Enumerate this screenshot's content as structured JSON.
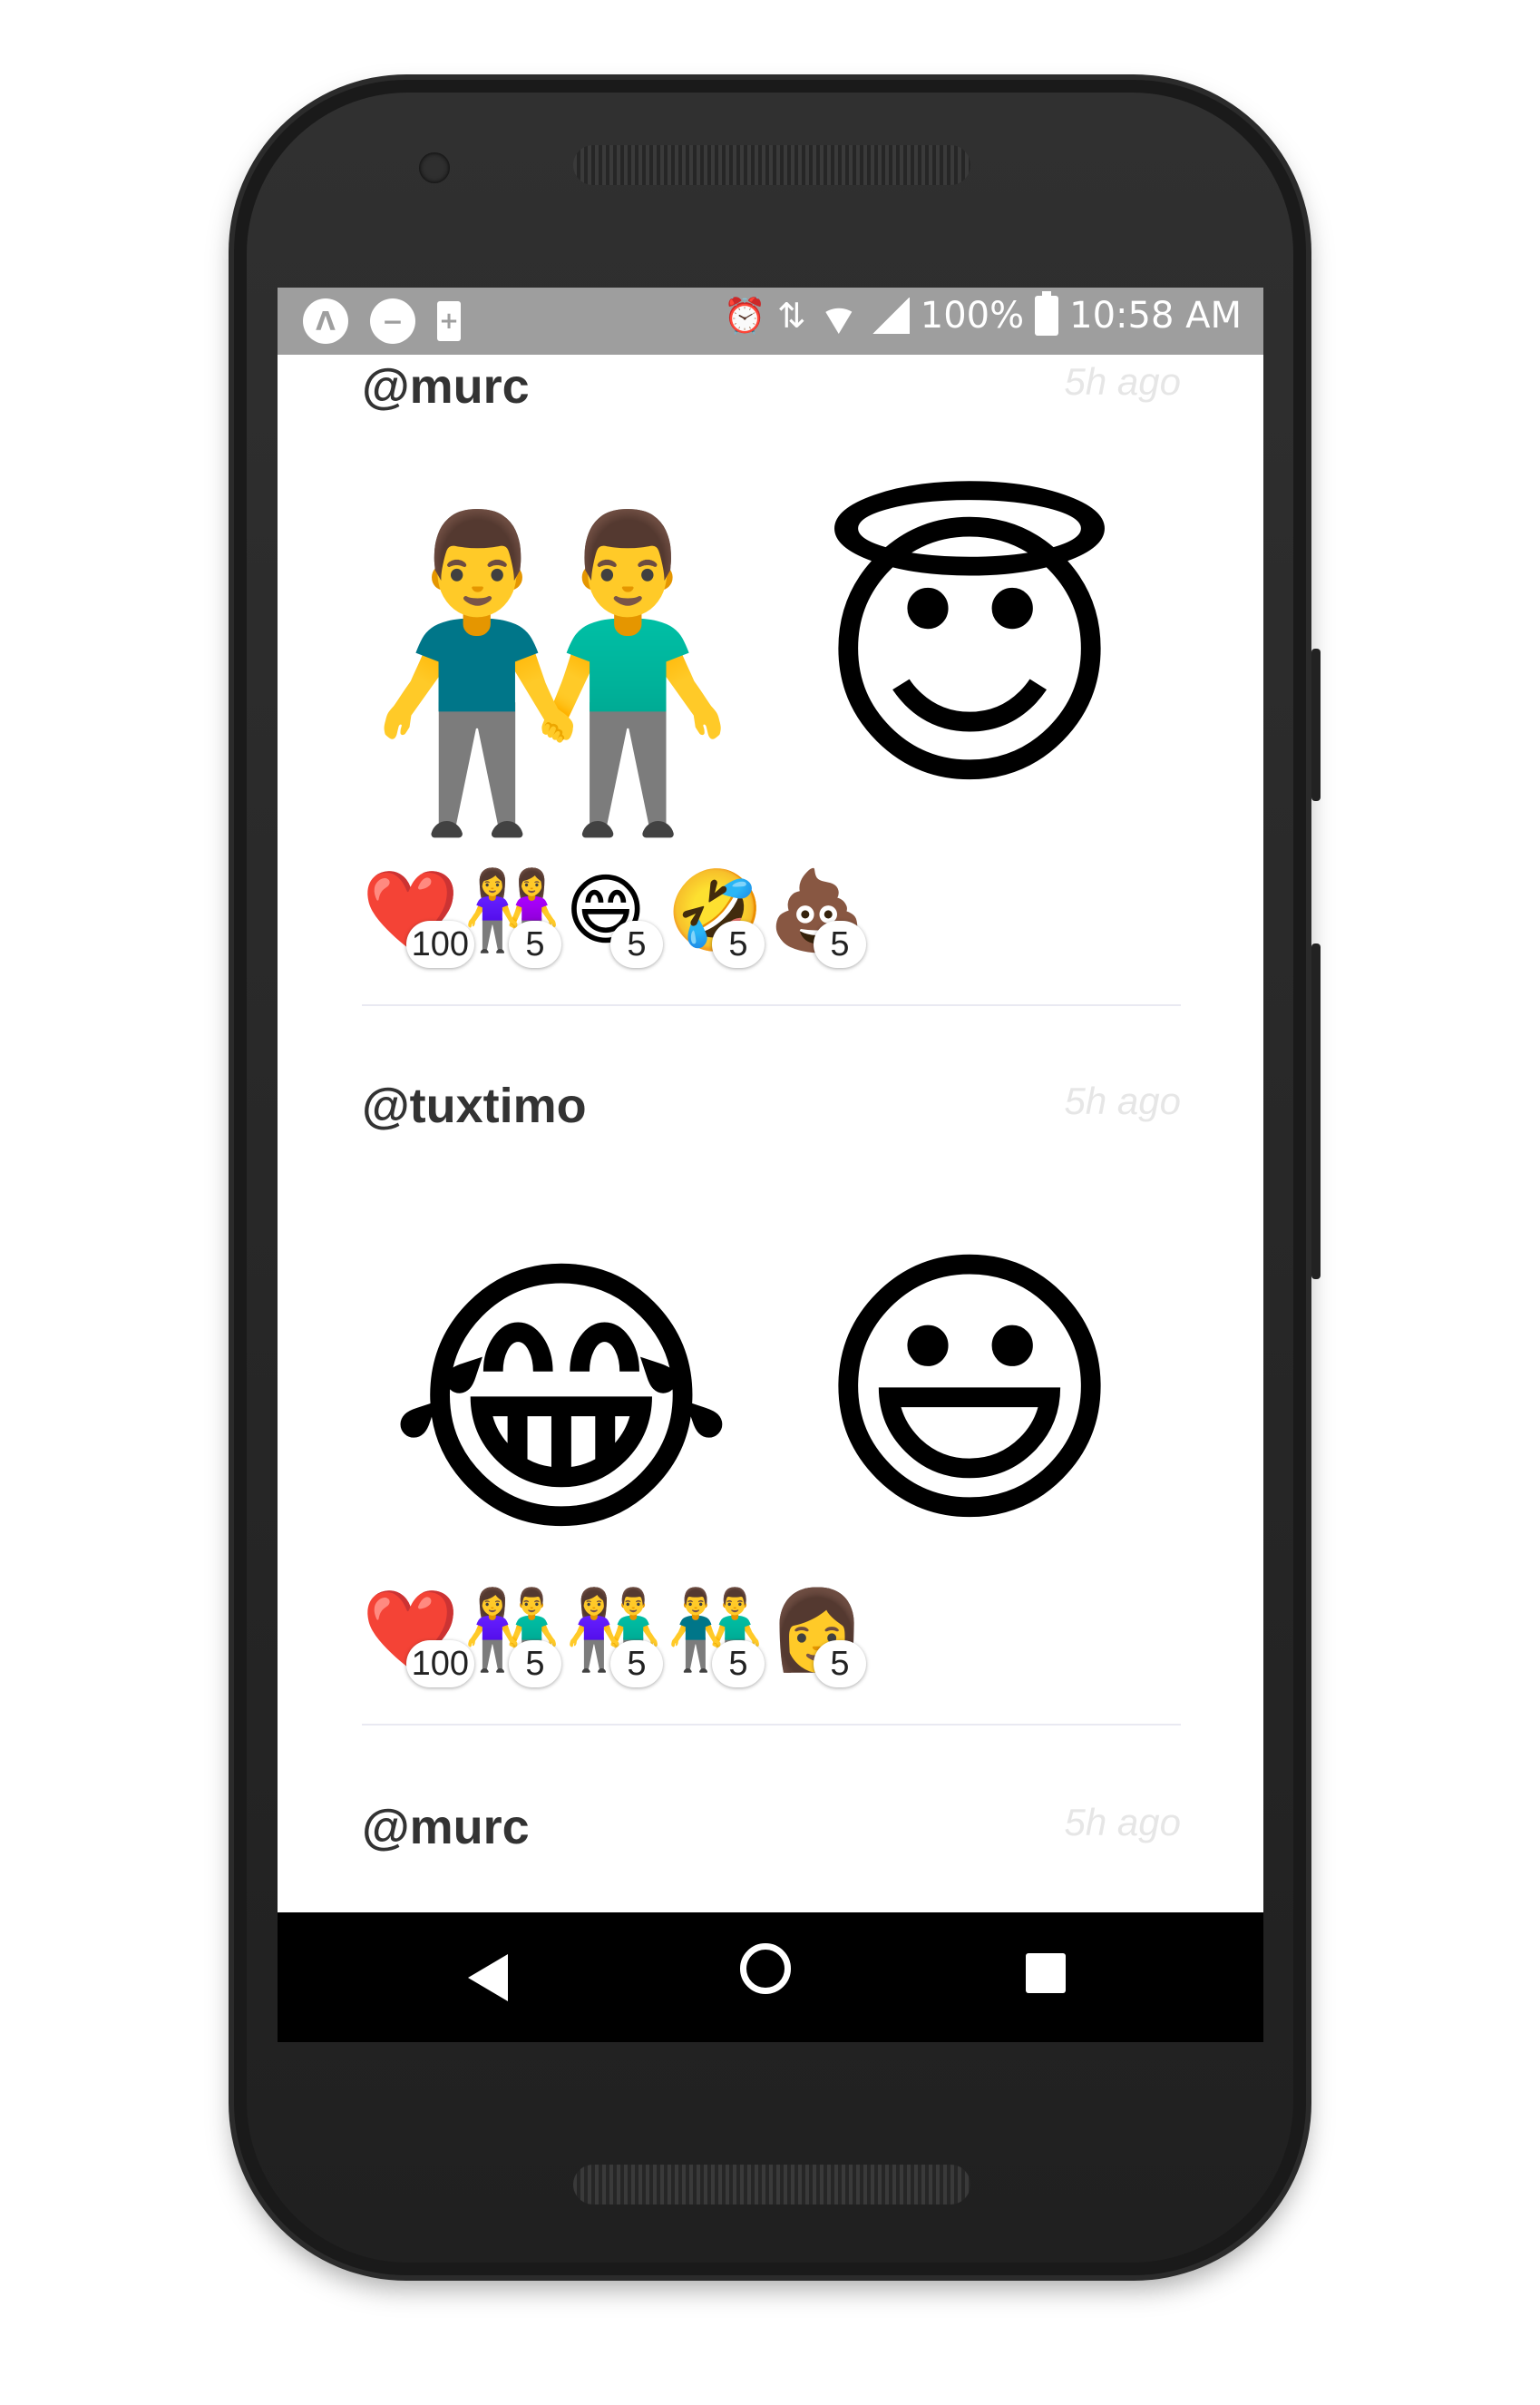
{
  "statusbar": {
    "left_icons": [
      "app-icon",
      "do-not-disturb-icon",
      "battery-saver-icon"
    ],
    "right_icons": [
      "alarm-icon",
      "data-arrows-icon",
      "wifi-icon",
      "signal-icon",
      "battery-icon"
    ],
    "battery_percent": "100%",
    "time": "10:58 AM"
  },
  "posts": [
    {
      "user": "@murc",
      "time": "5h ago",
      "emojis": [
        "👬",
        "😇"
      ],
      "reactions": [
        {
          "emoji": "❤️",
          "count": "100"
        },
        {
          "emoji": "👭",
          "count": "5"
        },
        {
          "emoji": "😄",
          "count": "5"
        },
        {
          "emoji": "🤣",
          "count": "5"
        },
        {
          "emoji": "💩",
          "count": "5"
        }
      ]
    },
    {
      "user": "@tuxtimo",
      "time": "5h ago",
      "emojis": [
        "😂",
        "😃"
      ],
      "reactions": [
        {
          "emoji": "❤️",
          "count": "100"
        },
        {
          "emoji": "👫",
          "count": "5"
        },
        {
          "emoji": "👫",
          "count": "5"
        },
        {
          "emoji": "👬",
          "count": "5"
        },
        {
          "emoji": "👩",
          "count": "5"
        }
      ]
    },
    {
      "user": "@murc",
      "time": "5h ago"
    }
  ],
  "navbar": {
    "buttons": [
      "back-icon",
      "home-icon",
      "recents-icon"
    ]
  }
}
